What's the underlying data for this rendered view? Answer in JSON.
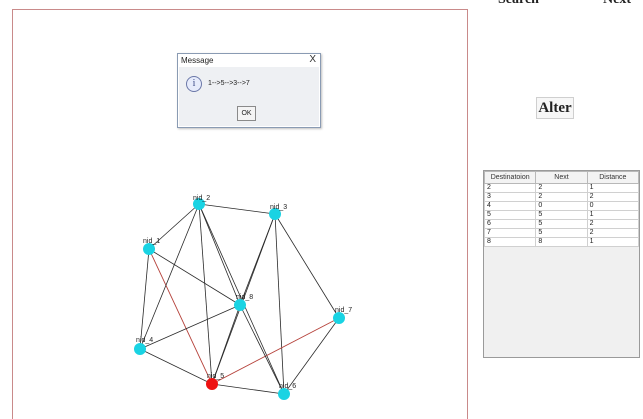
{
  "header": {
    "search_label": "Search",
    "next_label": "Next"
  },
  "alter_label": "Alter",
  "dialog": {
    "title": "Message",
    "close_glyph": "X",
    "message": "1-->5-->3-->7",
    "ok_label": "OK",
    "icon_glyph": "i"
  },
  "table": {
    "headers": [
      "Destinatoion",
      "Next",
      "Distance"
    ],
    "rows": [
      [
        "2",
        "2",
        "1"
      ],
      [
        "3",
        "2",
        "2"
      ],
      [
        "4",
        "0",
        "0"
      ],
      [
        "5",
        "5",
        "1"
      ],
      [
        "6",
        "5",
        "2"
      ],
      [
        "7",
        "5",
        "2"
      ],
      [
        "8",
        "8",
        "1"
      ]
    ]
  },
  "graph": {
    "nodes": [
      {
        "id": "1",
        "label": "nid_1",
        "selected": false
      },
      {
        "id": "2",
        "label": "nid_2",
        "selected": false
      },
      {
        "id": "3",
        "label": "nid_3",
        "selected": false
      },
      {
        "id": "4",
        "label": "nid_4",
        "selected": false
      },
      {
        "id": "5",
        "label": "nid_5",
        "selected": true
      },
      {
        "id": "6",
        "label": "nid_6",
        "selected": false
      },
      {
        "id": "7",
        "label": "nid_7",
        "selected": false
      },
      {
        "id": "8",
        "label": "nid_8",
        "selected": false
      }
    ],
    "edges": [
      [
        "1",
        "2"
      ],
      [
        "1",
        "4"
      ],
      [
        "1",
        "8"
      ],
      [
        "1",
        "5"
      ],
      [
        "2",
        "3"
      ],
      [
        "2",
        "4"
      ],
      [
        "2",
        "5"
      ],
      [
        "2",
        "8"
      ],
      [
        "2",
        "6"
      ],
      [
        "3",
        "8"
      ],
      [
        "3",
        "5"
      ],
      [
        "3",
        "7"
      ],
      [
        "3",
        "6"
      ],
      [
        "4",
        "5"
      ],
      [
        "4",
        "8"
      ],
      [
        "5",
        "6"
      ],
      [
        "5",
        "7"
      ],
      [
        "5",
        "8"
      ],
      [
        "6",
        "7"
      ],
      [
        "6",
        "8"
      ]
    ],
    "path_edges": [
      [
        "1",
        "5"
      ],
      [
        "5",
        "7"
      ]
    ],
    "colors": {
      "node": "#19d3e3",
      "selected_node": "#ee1111",
      "edge": "#2a2a2a",
      "path_edge": "#b5413a"
    }
  }
}
